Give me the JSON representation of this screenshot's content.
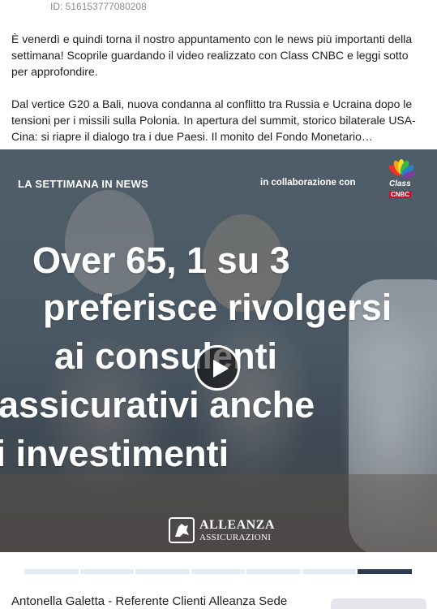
{
  "post": {
    "id_text": "ID: 516153777080208",
    "paragraphs": [
      "È venerdì e quindi torna il nostro appuntamento con le news più importanti della settimana! Scoprile guardando il video realizzato con Class CNBC e leggi sotto per approfondire.",
      "Dal vertice G20 a Bali, nuova condanna al conflitto tra Russia e Ucraina dopo le tensioni per i missili sulla Polonia. In apertura del summit, storico bilaterale USA-Cina: si riapre il dialogo tra i due Paesi. Il monito del Fondo Monetario…"
    ]
  },
  "video": {
    "label_left": "LA SETTIMANA IN NEWS",
    "label_right": "in collaborazione con",
    "partner_logo": {
      "class_text": "Class",
      "cnbc_text": "CNBC",
      "icon": "peacock-icon"
    },
    "headline_lines": [
      "Over 65, 1 su 3",
      "preferisce rivolgersi",
      "ai consulenti",
      "assicurativi anche",
      "li investimenti"
    ],
    "play_icon": "play-icon",
    "brand_logo": {
      "name": "ALLEANZA",
      "subtitle": "ASSICURAZIONI"
    }
  },
  "carousel": {
    "segments": 7,
    "active_index": 6
  },
  "footer": {
    "author_name": "Antonella Galetta - Referente Clienti Alleanza Sede"
  },
  "colors": {
    "progress_active": "#2a3b52",
    "progress_inactive": "#e4ebf2",
    "cnbc_red": "#c8102e"
  }
}
